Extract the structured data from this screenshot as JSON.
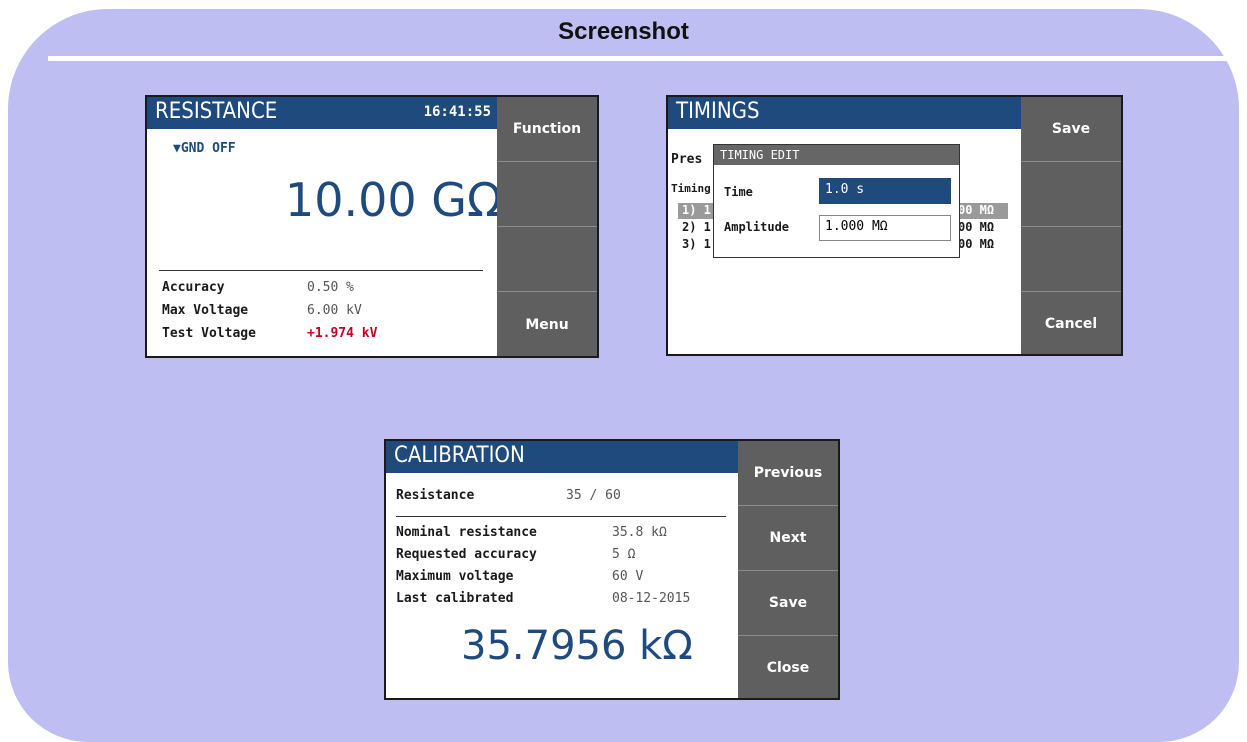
{
  "caption": "Screenshot",
  "resistance": {
    "title": "RESISTANCE",
    "time": "16:41:55",
    "gnd": "▼GND OFF",
    "value": "10.00 GΩ",
    "rows": [
      {
        "label": "Accuracy",
        "value": "0.50 %"
      },
      {
        "label": "Max Voltage",
        "value": "6.00 kV"
      },
      {
        "label": "Test Voltage",
        "value": "+1.974 kV"
      }
    ],
    "softkeys": [
      "Function",
      "",
      "",
      "Menu"
    ]
  },
  "timings": {
    "title": "TIMINGS",
    "preset_label_fragment": "Pres",
    "timing_label_fragment": "Timing",
    "list_left": [
      "1) 1",
      "2) 1",
      "3) 1"
    ],
    "list_right": [
      "00 MΩ",
      "00 MΩ",
      "00 MΩ"
    ],
    "dialog": {
      "title": "TIMING EDIT",
      "time_label": "Time",
      "time_value": "1.0 s",
      "amplitude_label": "Amplitude",
      "amplitude_value": "1.000 MΩ"
    },
    "softkeys": [
      "Save",
      "",
      "",
      "Cancel"
    ]
  },
  "calibration": {
    "title": "CALIBRATION",
    "resistance_label": "Resistance",
    "resistance_value": "35 / 60",
    "rows": [
      {
        "label": "Nominal resistance",
        "value": "35.8 kΩ"
      },
      {
        "label": "Requested accuracy",
        "value": "5 Ω"
      },
      {
        "label": "Maximum voltage",
        "value": "60 V"
      },
      {
        "label": "Last calibrated",
        "value": "08-12-2015"
      }
    ],
    "reading": "35.7956 kΩ",
    "softkeys": [
      "Previous",
      "Next",
      "Save",
      "Close"
    ]
  }
}
